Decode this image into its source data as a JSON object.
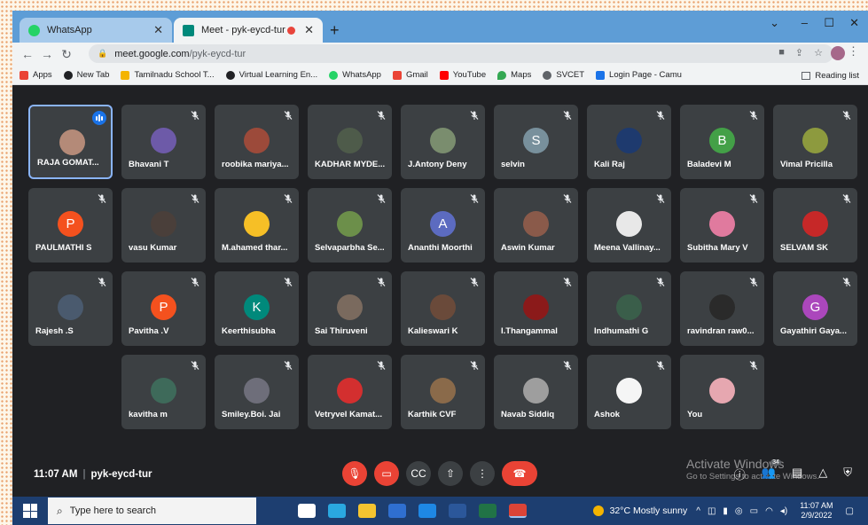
{
  "browser": {
    "tabs": [
      {
        "title": "WhatsApp",
        "favicon_color": "#25d366"
      },
      {
        "title": "Meet - pyk-eycd-tur",
        "favicon_color": "#00897b",
        "recording": true
      }
    ],
    "window_controls": [
      "⌄",
      "–",
      "☐",
      "✕"
    ],
    "url_host": "meet.google.com",
    "url_path": "/pyk-eycd-tur",
    "bookmarks": [
      {
        "label": "Apps",
        "color": "#ea4335"
      },
      {
        "label": "New Tab",
        "color": "#202124"
      },
      {
        "label": "Tamilnadu School T...",
        "color": "#f4b400"
      },
      {
        "label": "Virtual Learning En...",
        "color": "#202124"
      },
      {
        "label": "WhatsApp",
        "color": "#25d366"
      },
      {
        "label": "Gmail",
        "color": "#ea4335"
      },
      {
        "label": "YouTube",
        "color": "#ff0000"
      },
      {
        "label": "Maps",
        "color": "#34a853"
      },
      {
        "label": "SVCET",
        "color": "#5f6368"
      },
      {
        "label": "Login Page - Camu",
        "color": "#1a73e8"
      }
    ],
    "reading_list": "Reading list"
  },
  "meet": {
    "time": "11:07 AM",
    "code": "pyk-eycd-tur",
    "participant_badge": "34",
    "participants": [
      {
        "name": "RAJA GOMAT...",
        "color": "#b48a78",
        "initial": "",
        "active": true
      },
      {
        "name": "Bhavani T",
        "color": "#6d5aa8",
        "initial": ""
      },
      {
        "name": "roobika mariya...",
        "color": "#9c4a3a",
        "initial": ""
      },
      {
        "name": "KADHAR MYDE...",
        "color": "#4e5b4a",
        "initial": ""
      },
      {
        "name": "J.Antony Deny",
        "color": "#7a8d6e",
        "initial": ""
      },
      {
        "name": "selvin",
        "color": "#78909c",
        "initial": "S"
      },
      {
        "name": "Kali Raj",
        "color": "#1e3a6e",
        "initial": ""
      },
      {
        "name": "Baladevi M",
        "color": "#43a047",
        "initial": "B"
      },
      {
        "name": "Vimal Pricilla",
        "color": "#8d9a3e",
        "initial": ""
      },
      {
        "name": "PAULMATHI S",
        "color": "#f4511e",
        "initial": "P"
      },
      {
        "name": "vasu Kumar",
        "color": "#4a3f3a",
        "initial": ""
      },
      {
        "name": "M.ahamed thar...",
        "color": "#f6bf26",
        "initial": ""
      },
      {
        "name": "Selvaparbha Se...",
        "color": "#6c8f4a",
        "initial": ""
      },
      {
        "name": "Ananthi Moorthi",
        "color": "#5c6bc0",
        "initial": "A"
      },
      {
        "name": "Aswin Kumar",
        "color": "#8a5a4a",
        "initial": ""
      },
      {
        "name": "Meena Vallinay...",
        "color": "#e8e8e8",
        "initial": ""
      },
      {
        "name": "Subitha Mary V",
        "color": "#e07a9e",
        "initial": ""
      },
      {
        "name": "SELVAM SK",
        "color": "#c62828",
        "initial": ""
      },
      {
        "name": "Rajesh .S",
        "color": "#4a5a6e",
        "initial": ""
      },
      {
        "name": "Pavitha .V",
        "color": "#f4511e",
        "initial": "P"
      },
      {
        "name": "Keerthisubha",
        "color": "#00897b",
        "initial": "K"
      },
      {
        "name": "Sai Thiruveni",
        "color": "#7a6a5e",
        "initial": ""
      },
      {
        "name": "Kalieswari K",
        "color": "#6a4a3a",
        "initial": ""
      },
      {
        "name": "I.Thangammal",
        "color": "#8b1a1a",
        "initial": ""
      },
      {
        "name": "Indhumathi G",
        "color": "#3a5e4a",
        "initial": ""
      },
      {
        "name": "ravindran raw0...",
        "color": "#2a2a2a",
        "initial": ""
      },
      {
        "name": "Gayathiri Gaya...",
        "color": "#ab47bc",
        "initial": "G"
      },
      {
        "name": "kavitha m",
        "color": "#3e6a5a",
        "initial": ""
      },
      {
        "name": "Smiley.Boi. Jai",
        "color": "#6e6e7a",
        "initial": ""
      },
      {
        "name": "Vetryvel Kamat...",
        "color": "#d32f2f",
        "initial": ""
      },
      {
        "name": "Karthik CVF",
        "color": "#8a6a4a",
        "initial": ""
      },
      {
        "name": "Navab Siddiq",
        "color": "#9e9e9e",
        "initial": ""
      },
      {
        "name": "Ashok",
        "color": "#f5f5f5",
        "initial": ""
      },
      {
        "name": "You",
        "color": "#e6a7b0",
        "initial": ""
      }
    ],
    "activate_title": "Activate Windows",
    "activate_sub": "Go to Settings to activate Windows."
  },
  "taskbar": {
    "search_placeholder": "Type here to search",
    "apps": [
      {
        "name": "task-view",
        "color": "#ffffff"
      },
      {
        "name": "edge",
        "color": "#2aa8e0"
      },
      {
        "name": "file-explorer",
        "color": "#f4c430"
      },
      {
        "name": "store",
        "color": "#2f6fd0"
      },
      {
        "name": "mail",
        "color": "#1e88e5"
      },
      {
        "name": "word",
        "color": "#2b579a"
      },
      {
        "name": "excel",
        "color": "#217346"
      },
      {
        "name": "chrome",
        "color": "#db4437",
        "active": true
      }
    ],
    "weather": "32°C  Mostly sunny",
    "time": "11:07 AM",
    "date": "2/9/2022"
  }
}
